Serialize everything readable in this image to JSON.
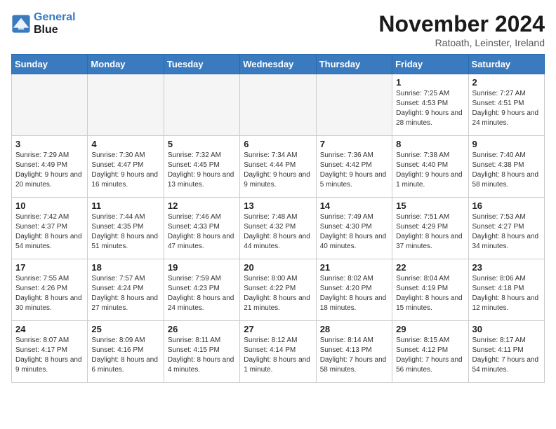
{
  "logo": {
    "line1": "General",
    "line2": "Blue"
  },
  "header": {
    "month": "November 2024",
    "location": "Ratoath, Leinster, Ireland"
  },
  "weekdays": [
    "Sunday",
    "Monday",
    "Tuesday",
    "Wednesday",
    "Thursday",
    "Friday",
    "Saturday"
  ],
  "weeks": [
    [
      {
        "day": "",
        "empty": true
      },
      {
        "day": "",
        "empty": true
      },
      {
        "day": "",
        "empty": true
      },
      {
        "day": "",
        "empty": true
      },
      {
        "day": "",
        "empty": true
      },
      {
        "day": "1",
        "sunrise": "7:25 AM",
        "sunset": "4:53 PM",
        "daylight": "9 hours and 28 minutes."
      },
      {
        "day": "2",
        "sunrise": "7:27 AM",
        "sunset": "4:51 PM",
        "daylight": "9 hours and 24 minutes."
      }
    ],
    [
      {
        "day": "3",
        "sunrise": "7:29 AM",
        "sunset": "4:49 PM",
        "daylight": "9 hours and 20 minutes."
      },
      {
        "day": "4",
        "sunrise": "7:30 AM",
        "sunset": "4:47 PM",
        "daylight": "9 hours and 16 minutes."
      },
      {
        "day": "5",
        "sunrise": "7:32 AM",
        "sunset": "4:45 PM",
        "daylight": "9 hours and 13 minutes."
      },
      {
        "day": "6",
        "sunrise": "7:34 AM",
        "sunset": "4:44 PM",
        "daylight": "9 hours and 9 minutes."
      },
      {
        "day": "7",
        "sunrise": "7:36 AM",
        "sunset": "4:42 PM",
        "daylight": "9 hours and 5 minutes."
      },
      {
        "day": "8",
        "sunrise": "7:38 AM",
        "sunset": "4:40 PM",
        "daylight": "9 hours and 1 minute."
      },
      {
        "day": "9",
        "sunrise": "7:40 AM",
        "sunset": "4:38 PM",
        "daylight": "8 hours and 58 minutes."
      }
    ],
    [
      {
        "day": "10",
        "sunrise": "7:42 AM",
        "sunset": "4:37 PM",
        "daylight": "8 hours and 54 minutes."
      },
      {
        "day": "11",
        "sunrise": "7:44 AM",
        "sunset": "4:35 PM",
        "daylight": "8 hours and 51 minutes."
      },
      {
        "day": "12",
        "sunrise": "7:46 AM",
        "sunset": "4:33 PM",
        "daylight": "8 hours and 47 minutes."
      },
      {
        "day": "13",
        "sunrise": "7:48 AM",
        "sunset": "4:32 PM",
        "daylight": "8 hours and 44 minutes."
      },
      {
        "day": "14",
        "sunrise": "7:49 AM",
        "sunset": "4:30 PM",
        "daylight": "8 hours and 40 minutes."
      },
      {
        "day": "15",
        "sunrise": "7:51 AM",
        "sunset": "4:29 PM",
        "daylight": "8 hours and 37 minutes."
      },
      {
        "day": "16",
        "sunrise": "7:53 AM",
        "sunset": "4:27 PM",
        "daylight": "8 hours and 34 minutes."
      }
    ],
    [
      {
        "day": "17",
        "sunrise": "7:55 AM",
        "sunset": "4:26 PM",
        "daylight": "8 hours and 30 minutes."
      },
      {
        "day": "18",
        "sunrise": "7:57 AM",
        "sunset": "4:24 PM",
        "daylight": "8 hours and 27 minutes."
      },
      {
        "day": "19",
        "sunrise": "7:59 AM",
        "sunset": "4:23 PM",
        "daylight": "8 hours and 24 minutes."
      },
      {
        "day": "20",
        "sunrise": "8:00 AM",
        "sunset": "4:22 PM",
        "daylight": "8 hours and 21 minutes."
      },
      {
        "day": "21",
        "sunrise": "8:02 AM",
        "sunset": "4:20 PM",
        "daylight": "8 hours and 18 minutes."
      },
      {
        "day": "22",
        "sunrise": "8:04 AM",
        "sunset": "4:19 PM",
        "daylight": "8 hours and 15 minutes."
      },
      {
        "day": "23",
        "sunrise": "8:06 AM",
        "sunset": "4:18 PM",
        "daylight": "8 hours and 12 minutes."
      }
    ],
    [
      {
        "day": "24",
        "sunrise": "8:07 AM",
        "sunset": "4:17 PM",
        "daylight": "8 hours and 9 minutes."
      },
      {
        "day": "25",
        "sunrise": "8:09 AM",
        "sunset": "4:16 PM",
        "daylight": "8 hours and 6 minutes."
      },
      {
        "day": "26",
        "sunrise": "8:11 AM",
        "sunset": "4:15 PM",
        "daylight": "8 hours and 4 minutes."
      },
      {
        "day": "27",
        "sunrise": "8:12 AM",
        "sunset": "4:14 PM",
        "daylight": "8 hours and 1 minute."
      },
      {
        "day": "28",
        "sunrise": "8:14 AM",
        "sunset": "4:13 PM",
        "daylight": "7 hours and 58 minutes."
      },
      {
        "day": "29",
        "sunrise": "8:15 AM",
        "sunset": "4:12 PM",
        "daylight": "7 hours and 56 minutes."
      },
      {
        "day": "30",
        "sunrise": "8:17 AM",
        "sunset": "4:11 PM",
        "daylight": "7 hours and 54 minutes."
      }
    ]
  ]
}
